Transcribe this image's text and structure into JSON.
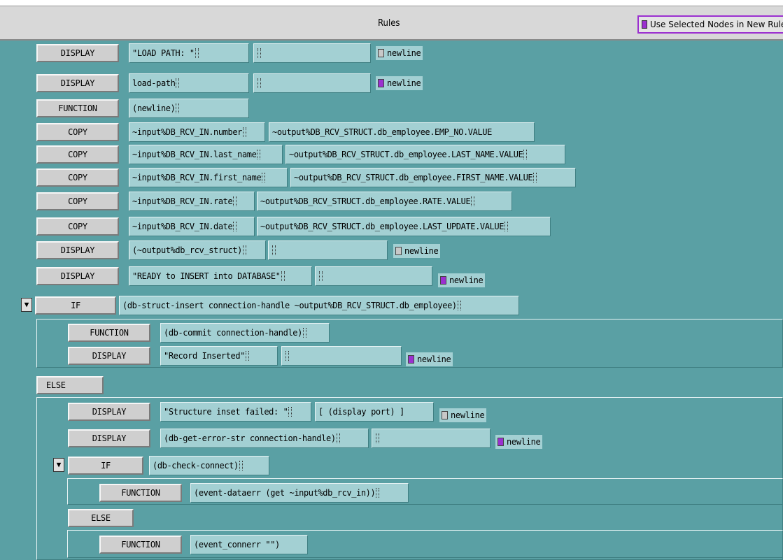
{
  "header": {
    "title": "Rules",
    "use_selected_label": "Use Selected Nodes in New Rules"
  },
  "rules": [
    {
      "op": "DISPLAY",
      "f1": "\"LOAD PATH: \"",
      "f2": "",
      "newline": "newline",
      "checked": false
    },
    {
      "op": "DISPLAY",
      "f1": "load-path",
      "f2": "",
      "newline": "newline",
      "checked": true
    },
    {
      "op": "FUNCTION",
      "f1": "(newline)"
    },
    {
      "op": "COPY",
      "f1": "~input%DB_RCV_IN.number",
      "f2": "~output%DB_RCV_STRUCT.db_employee.EMP_NO.VALUE"
    },
    {
      "op": "COPY",
      "f1": "~input%DB_RCV_IN.last_name",
      "f2": "~output%DB_RCV_STRUCT.db_employee.LAST_NAME.VALUE"
    },
    {
      "op": "COPY",
      "f1": "~input%DB_RCV_IN.first_name",
      "f2": "~output%DB_RCV_STRUCT.db_employee.FIRST_NAME.VALUE"
    },
    {
      "op": "COPY",
      "f1": "~input%DB_RCV_IN.rate",
      "f2": "~output%DB_RCV_STRUCT.db_employee.RATE.VALUE"
    },
    {
      "op": "COPY",
      "f1": "~input%DB_RCV_IN.date",
      "f2": "~output%DB_RCV_STRUCT.db_employee.LAST_UPDATE.VALUE"
    },
    {
      "op": "DISPLAY",
      "f1": "(~output%db_rcv_struct)",
      "f2": "",
      "newline": "newline",
      "checked": false
    },
    {
      "op": "DISPLAY",
      "f1": "\"READY to INSERT into DATABASE\"",
      "f2": "",
      "newline": "newline",
      "checked": true
    },
    {
      "op": "IF",
      "f1": "(db-struct-insert connection-handle ~output%DB_RCV_STRUCT.db_employee)"
    },
    {
      "op": "FUNCTION",
      "f1": "(db-commit connection-handle)"
    },
    {
      "op": "DISPLAY",
      "f1": "\"Record Inserted\"",
      "f2": "",
      "newline": "newline",
      "checked": true
    },
    {
      "op": "ELSE"
    },
    {
      "op": "DISPLAY",
      "f1": "\"Structure inset failed: \"",
      "f2": "[ (display port) ]",
      "newline": "newline",
      "checked": false
    },
    {
      "op": "DISPLAY",
      "f1": "(db-get-error-str connection-handle)",
      "f2": "",
      "newline": "newline",
      "checked": true
    },
    {
      "op": "IF",
      "f1": "(db-check-connect)"
    },
    {
      "op": "FUNCTION",
      "f1": "(event-dataerr (get ~input%db_rcv_in))"
    },
    {
      "op": "ELSE"
    },
    {
      "op": "FUNCTION",
      "f1": "(event_connerr \"\")"
    }
  ],
  "colors": {
    "accent": "#9b30d0",
    "canvas": "#5aa0a4",
    "field": "#a3d0d3"
  }
}
